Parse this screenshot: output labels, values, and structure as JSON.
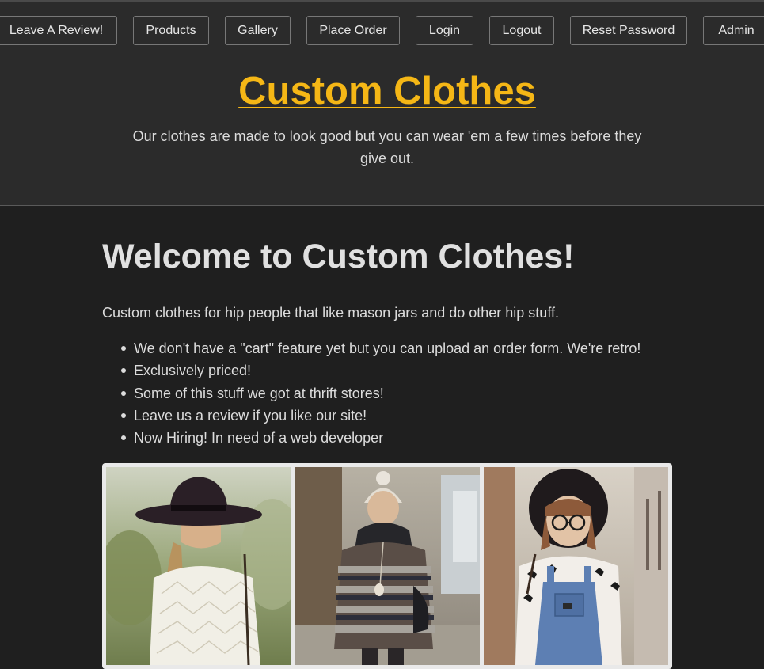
{
  "nav": [
    {
      "label": "Leave A Review!"
    },
    {
      "label": "Products"
    },
    {
      "label": "Gallery"
    },
    {
      "label": "Place Order"
    },
    {
      "label": "Login"
    },
    {
      "label": "Logout"
    },
    {
      "label": "Reset Password"
    },
    {
      "label": "Admin"
    }
  ],
  "header": {
    "site_title": "Custom Clothes",
    "tagline": "Our clothes are made to look good but you can wear 'em a few times before they give out."
  },
  "main": {
    "heading": "Welcome to Custom Clothes!",
    "intro": "Custom clothes for hip people that like mason jars and do other hip stuff.",
    "features": [
      "We don't have a \"cart\" feature yet but you can upload an order form. We're retro!",
      "Exclusively priced!",
      "Some of this stuff we got at thrift stores!",
      "Leave us a review if you like our site!",
      "Now Hiring! In need of a web developer"
    ]
  },
  "colors": {
    "brand": "#f5b716",
    "header_bg": "#2b2b2b",
    "page_bg": "#1f1f1f"
  }
}
